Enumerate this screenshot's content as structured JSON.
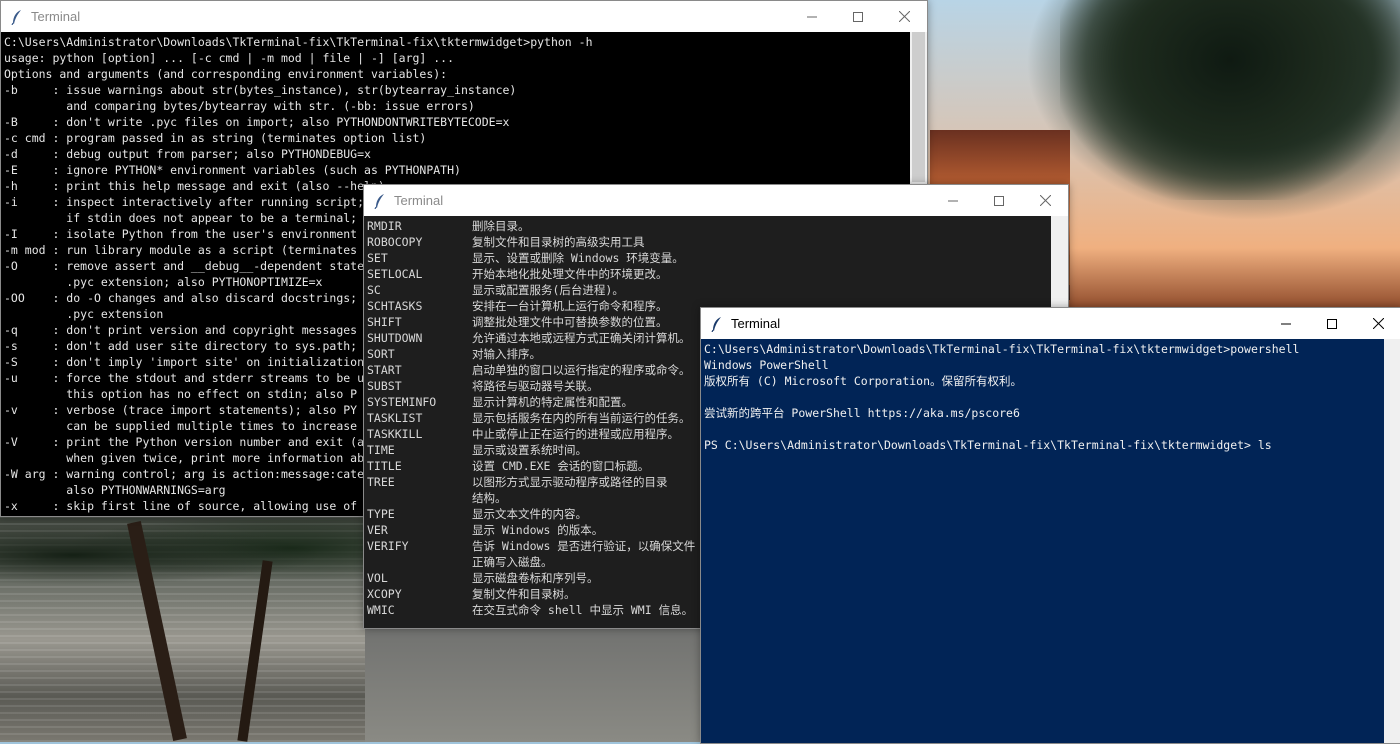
{
  "windows": {
    "python": {
      "title": "Terminal",
      "lines": [
        "C:\\Users\\Administrator\\Downloads\\TkTerminal-fix\\TkTerminal-fix\\tktermwidget>python -h",
        "usage: python [option] ... [-c cmd | -m mod | file | -] [arg] ...",
        "Options and arguments (and corresponding environment variables):",
        "-b     : issue warnings about str(bytes_instance), str(bytearray_instance)",
        "         and comparing bytes/bytearray with str. (-bb: issue errors)",
        "-B     : don't write .pyc files on import; also PYTHONDONTWRITEBYTECODE=x",
        "-c cmd : program passed in as string (terminates option list)",
        "-d     : debug output from parser; also PYTHONDEBUG=x",
        "-E     : ignore PYTHON* environment variables (such as PYTHONPATH)",
        "-h     : print this help message and exit (also --help)",
        "-i     : inspect interactively after running script;",
        "         if stdin does not appear to be a terminal;",
        "-I     : isolate Python from the user's environment",
        "-m mod : run library module as a script (terminates",
        "-O     : remove assert and __debug__-dependent state",
        "         .pyc extension; also PYTHONOPTIMIZE=x",
        "-OO    : do -O changes and also discard docstrings;",
        "         .pyc extension",
        "-q     : don't print version and copyright messages",
        "-s     : don't add user site directory to sys.path;",
        "-S     : don't imply 'import site' on initialization",
        "-u     : force the stdout and stderr streams to be u",
        "         this option has no effect on stdin; also P",
        "-v     : verbose (trace import statements); also PY",
        "         can be supplied multiple times to increase",
        "-V     : print the Python version number and exit (a",
        "         when given twice, print more information ab",
        "-W arg : warning control; arg is action:message:cate",
        "         also PYTHONWARNINGS=arg",
        "-x     : skip first line of source, allowing use of"
      ]
    },
    "cmdhelp": {
      "title": "Terminal",
      "rows": [
        {
          "cmd": "RMDIR",
          "desc": "删除目录。"
        },
        {
          "cmd": "ROBOCOPY",
          "desc": "复制文件和目录树的高级实用工具"
        },
        {
          "cmd": "SET",
          "desc": "显示、设置或删除 Windows 环境变量。"
        },
        {
          "cmd": "SETLOCAL",
          "desc": "开始本地化批处理文件中的环境更改。"
        },
        {
          "cmd": "SC",
          "desc": "显示或配置服务(后台进程)。"
        },
        {
          "cmd": "SCHTASKS",
          "desc": "安排在一台计算机上运行命令和程序。"
        },
        {
          "cmd": "SHIFT",
          "desc": "调整批处理文件中可替换参数的位置。"
        },
        {
          "cmd": "SHUTDOWN",
          "desc": "允许通过本地或远程方式正确关闭计算机。"
        },
        {
          "cmd": "SORT",
          "desc": "对输入排序。"
        },
        {
          "cmd": "START",
          "desc": "启动单独的窗口以运行指定的程序或命令。"
        },
        {
          "cmd": "SUBST",
          "desc": "将路径与驱动器号关联。"
        },
        {
          "cmd": "SYSTEMINFO",
          "desc": "显示计算机的特定属性和配置。"
        },
        {
          "cmd": "TASKLIST",
          "desc": "显示包括服务在内的所有当前运行的任务。"
        },
        {
          "cmd": "TASKKILL",
          "desc": "中止或停止正在运行的进程或应用程序。"
        },
        {
          "cmd": "TIME",
          "desc": "显示或设置系统时间。"
        },
        {
          "cmd": "TITLE",
          "desc": "设置 CMD.EXE 会话的窗口标题。"
        },
        {
          "cmd": "TREE",
          "desc": "以图形方式显示驱动程序或路径的目录"
        },
        {
          "cmd": "",
          "desc": "结构。"
        },
        {
          "cmd": "TYPE",
          "desc": "显示文本文件的内容。"
        },
        {
          "cmd": "VER",
          "desc": "显示 Windows 的版本。"
        },
        {
          "cmd": "VERIFY",
          "desc": "告诉 Windows 是否进行验证，以确保文件"
        },
        {
          "cmd": "",
          "desc": "正确写入磁盘。"
        },
        {
          "cmd": "VOL",
          "desc": "显示磁盘卷标和序列号。"
        },
        {
          "cmd": "XCOPY",
          "desc": "复制文件和目录树。"
        },
        {
          "cmd": "WMIC",
          "desc": "在交互式命令 shell 中显示 WMI 信息。"
        }
      ]
    },
    "powershell": {
      "title": "Terminal",
      "lines": [
        "C:\\Users\\Administrator\\Downloads\\TkTerminal-fix\\TkTerminal-fix\\tktermwidget>powershell",
        "Windows PowerShell",
        "版权所有 (C) Microsoft Corporation。保留所有权利。",
        "",
        "尝试新的跨平台 PowerShell https://aka.ms/pscore6",
        "",
        "PS C:\\Users\\Administrator\\Downloads\\TkTerminal-fix\\TkTerminal-fix\\tktermwidget> ls"
      ]
    }
  },
  "icons": {
    "app": "feather-icon",
    "minimize": "minimize-icon",
    "maximize": "maximize-icon",
    "close": "close-icon"
  },
  "colors": {
    "python_bg": "#000000",
    "cmd_bg": "#1e1e1e",
    "powershell_bg": "#012456"
  }
}
